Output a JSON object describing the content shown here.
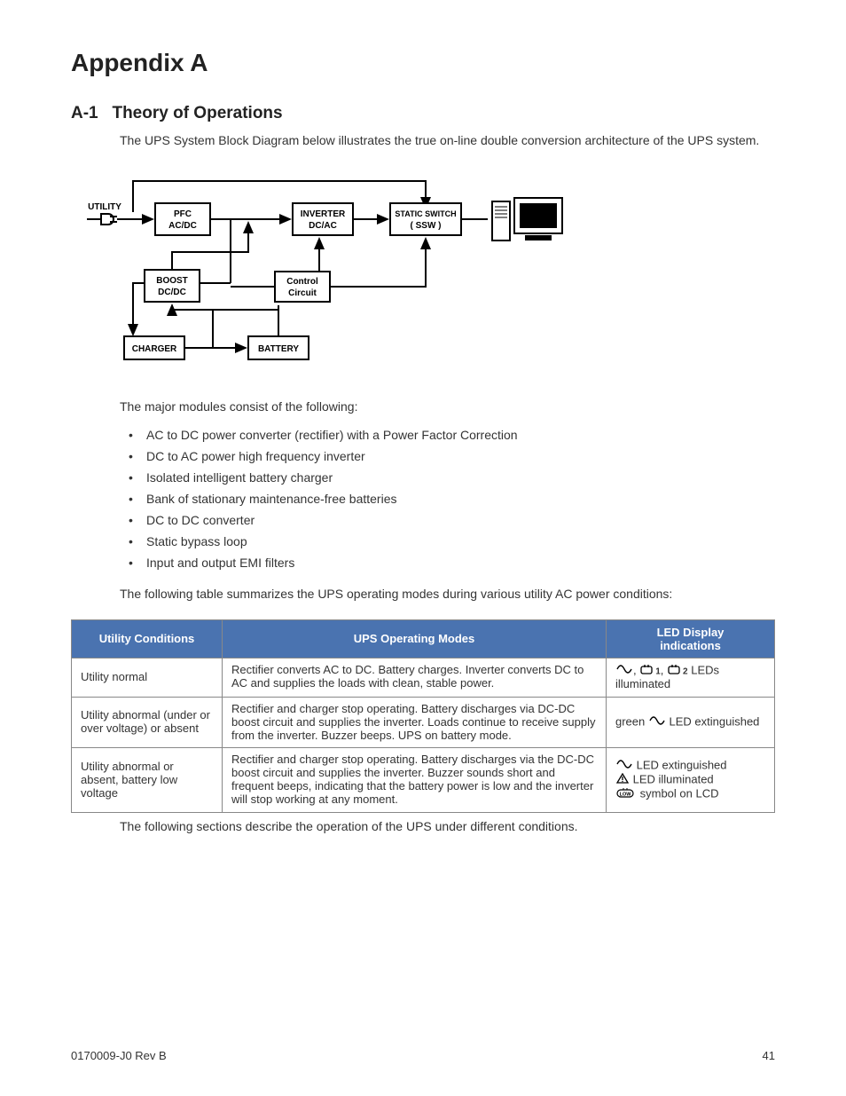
{
  "heading": "Appendix A",
  "section": {
    "number": "A-1",
    "title": "Theory of Operations"
  },
  "intro": "The UPS System Block Diagram below illustrates the true on-line double conversion architecture of the UPS system.",
  "diagram": {
    "utility": "UTILITY",
    "pfc_l1": "PFC",
    "pfc_l2": "AC/DC",
    "inverter_l1": "INVERTER",
    "inverter_l2": "DC/AC",
    "ssw_l1": "STATIC SWITCH",
    "ssw_l2": "( SSW )",
    "boost_l1": "BOOST",
    "boost_l2": "DC/DC",
    "control_l1": "Control",
    "control_l2": "Circuit",
    "charger": "CHARGER",
    "battery": "BATTERY"
  },
  "modules_intro": "The major modules consist of the following:",
  "modules": [
    "AC to DC power converter (rectifier) with a Power Factor Correction",
    "DC to AC power high frequency inverter",
    "Isolated intelligent battery charger",
    "Bank of stationary maintenance-free batteries",
    "DC to DC converter",
    "Static bypass loop",
    "Input and output EMI filters"
  ],
  "table_intro": "The following table summarizes the UPS operating modes during various utility AC power conditions:",
  "table": {
    "headers": {
      "col1": "Utility Conditions",
      "col2": "UPS Operating Modes",
      "col3_l1": "LED Display",
      "col3_l2": "indications"
    },
    "rows": [
      {
        "cond": "Utility normal",
        "mode": "Rectifier converts AC to DC. Battery charges. Inverter converts DC to AC and supplies the loads with clean, stable power.",
        "led_tail": " LEDs illuminated",
        "sub1": "1",
        "sub2": "2",
        "comma": ", "
      },
      {
        "cond": "Utility abnormal (under or over voltage) or absent",
        "mode": "Rectifier and charger stop operating. Battery discharges via DC-DC boost circuit and supplies the inverter. Loads continue to receive supply from the inverter. Buzzer beeps. UPS on battery mode.",
        "led_pre": "green  ",
        "led_tail": " LED extinguished"
      },
      {
        "cond": "Utility abnormal or absent, battery low voltage",
        "mode": "Rectifier and charger stop operating. Battery discharges via the DC-DC boost circuit and supplies the inverter. Buzzer sounds short and frequent beeps, indicating that the battery power is low and the inverter will stop working at any moment.",
        "led_l1": " LED extinguished",
        "led_l2": " LED illuminated",
        "led_l3": " symbol on LCD"
      }
    ]
  },
  "outro": "The following sections describe the operation of the UPS under different conditions.",
  "footer": {
    "left": "0170009-J0    Rev B",
    "right": "41"
  }
}
